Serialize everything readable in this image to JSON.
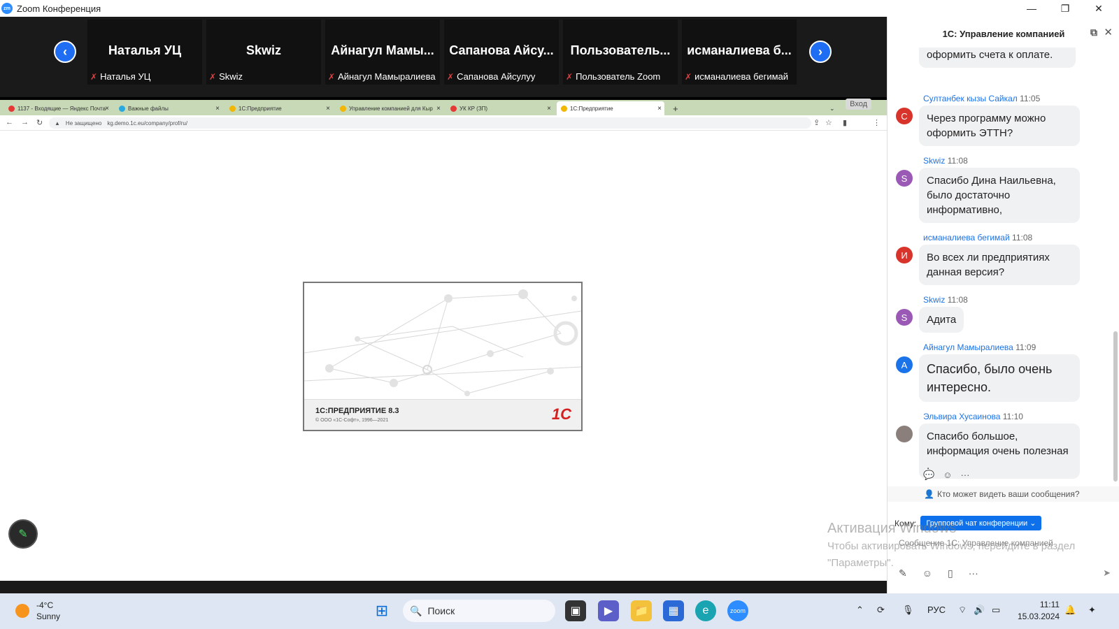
{
  "window": {
    "app_icon_text": "zm",
    "title": "Zoom Конференция",
    "controls": [
      "—",
      "❐",
      "✕"
    ]
  },
  "participants": [
    {
      "display": "Наталья УЦ",
      "name": "Наталья УЦ"
    },
    {
      "display": "Skwiz",
      "name": "Skwiz"
    },
    {
      "display": "Айнагул Мамы...",
      "name": "Айнагул Мамыралиева"
    },
    {
      "display": "Сапанова Айсу...",
      "name": "Сапанова Айсулуу"
    },
    {
      "display": "Пользователь...",
      "name": "Пользователь Zoom"
    },
    {
      "display": "исманалиева б...",
      "name": "исманалиева бегимай"
    }
  ],
  "nav": {
    "prev": "‹",
    "next": "›"
  },
  "browser": {
    "tabs": [
      {
        "label": "1137 - Входящие — Яндекс Почта",
        "color": "#e53935"
      },
      {
        "label": "Важные файлы",
        "color": "#29a9e0"
      },
      {
        "label": "1С:Предприятие",
        "color": "#f2b705"
      },
      {
        "label": "Управление компанией для Кыр",
        "color": "#f2b705"
      },
      {
        "label": "УК КР (ЗП)",
        "color": "#e53935"
      },
      {
        "label": "1С:Предприятие",
        "color": "#f2b705"
      }
    ],
    "new_tab": "+",
    "security": "Не защищено",
    "url": "kg.demo.1c.eu/company/prof/ru/",
    "login_button": "Вход"
  },
  "splash": {
    "product": "1С:ПРЕДПРИЯТИЕ 8.3",
    "copyright": "© ООО «1С-Софт», 1996—2021",
    "logo": "1С"
  },
  "chat": {
    "title": "1С: Управление компанией",
    "partial_message": "оформить счета к оплате.",
    "messages": [
      {
        "sender": "Султанбек кызы Сайкал",
        "time": "11:05",
        "avatar_letter": "С",
        "avatar_color": "#d9342b",
        "text": "Через программу можно оформить ЭТТН?"
      },
      {
        "sender": "Skwiz",
        "time": "11:08",
        "avatar_letter": "S",
        "avatar_color": "#9b59b6",
        "text": "Спасибо Дина Наильевна, было достаточно информативно,"
      },
      {
        "sender": "исманалиева бегимай",
        "time": "11:08",
        "avatar_letter": "И",
        "avatar_color": "#d9342b",
        "text": "Во всех ли предприятиях данная версия?"
      },
      {
        "sender": "Skwiz",
        "time": "11:08",
        "avatar_letter": "S",
        "avatar_color": "#9b59b6",
        "text": "Адита"
      },
      {
        "sender": "Айнагул Мамыралиева",
        "time": "11:09",
        "avatar_letter": "A",
        "avatar_color": "#1a73e8",
        "text": "Спасибо, было очень интересно."
      },
      {
        "sender": "Эльвира Хусаинова",
        "time": "11:10",
        "avatar_letter": "",
        "avatar_color": "#8a7f7a",
        "text": "Спасибо большое, информация очень полезная ."
      }
    ],
    "who_can_see": "Кто может видеть ваши сообщения?",
    "to_label": "Кому:",
    "to_value": "Групповой чат конференции",
    "input_placeholder": "Сообщение 1С: Управление компанией"
  },
  "watermark": {
    "line1": "Активация Windows",
    "line2": "Чтобы активировать Windows, перейдите в раздел",
    "line3": "\"Параметры\"."
  },
  "taskbar": {
    "temperature": "-4°C",
    "condition": "Sunny",
    "search": "Поиск",
    "language": "РУС",
    "time": "11:11",
    "date": "15.03.2024"
  }
}
